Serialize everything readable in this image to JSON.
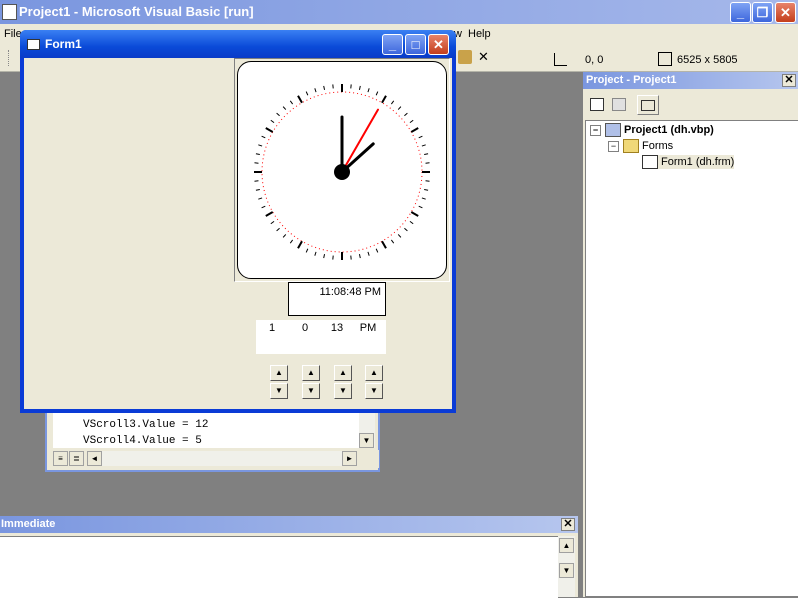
{
  "main_window": {
    "title": "Project1 - Microsoft Visual Basic [run]",
    "minimize": "_",
    "restore": "❐",
    "close": "✕"
  },
  "menu": {
    "file": "File",
    "view_tail": "w",
    "help": "Help"
  },
  "toolbar": {
    "position": "0, 0",
    "size": "6525 x 5805"
  },
  "form1": {
    "title": "Form1",
    "time_display": "11:08:48 PM",
    "values": [
      "1",
      "0",
      "13",
      "PM"
    ],
    "clock": {
      "hour_hand_minutes": 8,
      "minute_hand_minutes": 0,
      "second_hand_seconds": 5,
      "second_hand_color": "#ff0000"
    }
  },
  "code_window": {
    "lines": [
      "VScroll3.Value = 12",
      "VScroll4.Value = 5"
    ]
  },
  "project_explorer": {
    "title": "Project - Project1",
    "close": "✕",
    "tree": {
      "project": "Project1 (dh.vbp)",
      "forms_folder": "Forms",
      "form_item": "Form1 (dh.frm)"
    }
  },
  "immediate": {
    "title": "Immediate",
    "close": "✕"
  }
}
